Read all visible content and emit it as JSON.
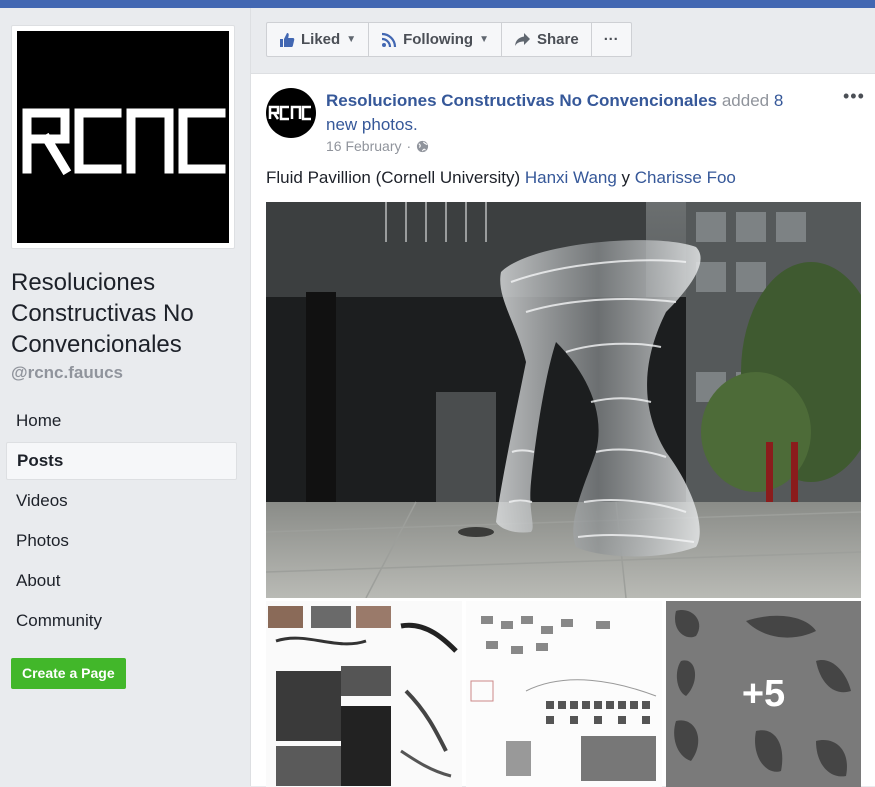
{
  "sidebar": {
    "logo_text": "RCNC",
    "page_name": "Resoluciones Constructivas No Convencionales",
    "handle": "@rcnc.fauucs",
    "nav": [
      {
        "label": "Home"
      },
      {
        "label": "Posts",
        "active": true
      },
      {
        "label": "Videos"
      },
      {
        "label": "Photos"
      },
      {
        "label": "About"
      },
      {
        "label": "Community"
      }
    ],
    "create_page_label": "Create a Page"
  },
  "actions": {
    "liked_label": "Liked",
    "following_label": "Following",
    "share_label": "Share",
    "more_label": "···"
  },
  "post": {
    "avatar_text": "RCNC",
    "author": "Resoluciones Constructivas No Convencionales",
    "action_text": "added",
    "action_link": "8 new photos.",
    "date": "16 February",
    "menu_label": "•••",
    "text_prefix": "Fluid Pavillion (Cornell University) ",
    "text_link1": "Hanxi Wang",
    "text_mid": " y ",
    "text_link2": "Charisse Foo",
    "more_photos": "+5"
  },
  "colors": {
    "brand": "#4267b2",
    "link": "#365899",
    "create_button": "#42b72a"
  }
}
